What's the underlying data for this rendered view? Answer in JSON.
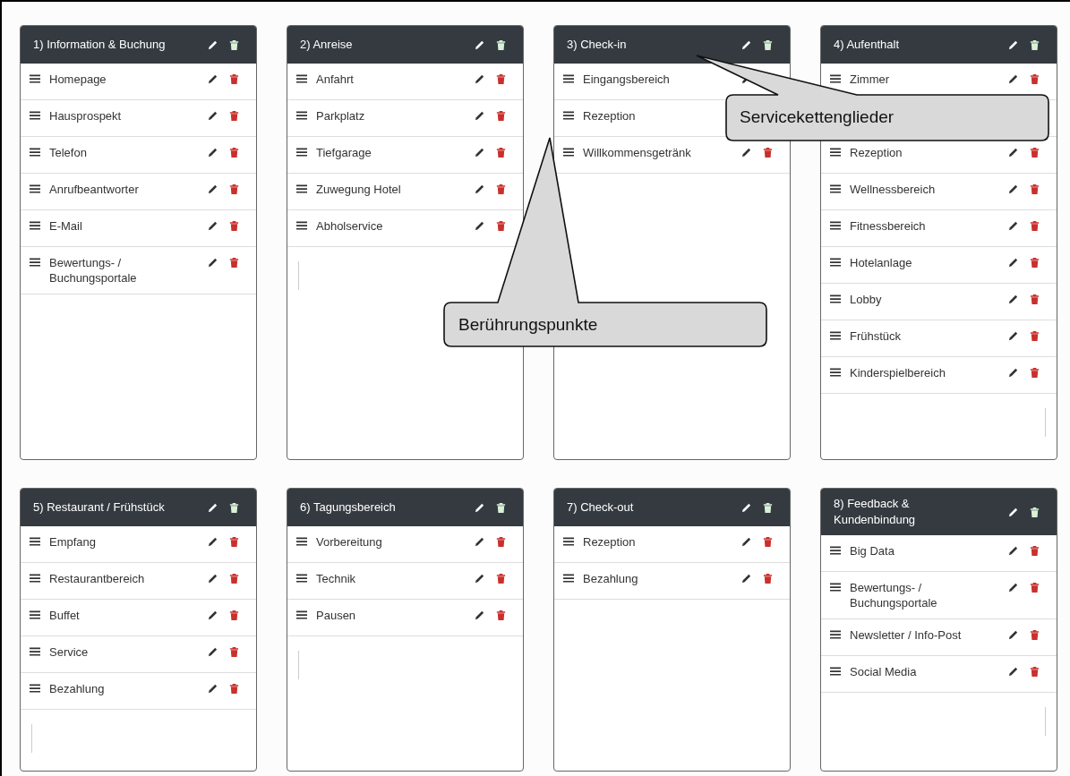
{
  "cards": [
    {
      "title": "1) Information & Buchung",
      "items": [
        {
          "kind": "entry",
          "label": "Homepage"
        },
        {
          "kind": "entry",
          "label": "Hausprospekt"
        },
        {
          "kind": "entry",
          "label": "Telefon"
        },
        {
          "kind": "entry",
          "label": "Anrufbeantworter"
        },
        {
          "kind": "entry",
          "label": "E-Mail"
        },
        {
          "kind": "entry",
          "label": "Bewertungs- / Buchungsportale"
        }
      ]
    },
    {
      "title": "2) Anreise",
      "input": {
        "kind": "left"
      },
      "items": [
        {
          "kind": "entry",
          "label": "Anfahrt"
        },
        {
          "kind": "entry",
          "label": "Parkplatz"
        },
        {
          "kind": "entry",
          "label": "Tiefgarage"
        },
        {
          "kind": "entry",
          "label": "Zuwegung Hotel"
        },
        {
          "kind": "entry",
          "label": "Abholservice"
        }
      ]
    },
    {
      "title": "3) Check-in",
      "items": [
        {
          "kind": "pencil-only",
          "label": "Eingangsbereich"
        },
        {
          "kind": "label-only",
          "label": "Rezeption"
        },
        {
          "kind": "entry",
          "label": "Willkommensgetränk"
        }
      ]
    },
    {
      "title": "4) Aufenthalt",
      "input": {
        "kind": "right"
      },
      "items": [
        {
          "kind": "entry",
          "label": "Zimmer"
        },
        {
          "kind": "covered"
        },
        {
          "kind": "entry",
          "label": "Rezeption"
        },
        {
          "kind": "entry",
          "label": "Wellnessbereich"
        },
        {
          "kind": "entry",
          "label": "Fitnessbereich"
        },
        {
          "kind": "entry",
          "label": "Hotelanlage"
        },
        {
          "kind": "entry",
          "label": "Lobby"
        },
        {
          "kind": "entry",
          "label": "Frühstück"
        },
        {
          "kind": "entry",
          "label": "Kinderspielbereich"
        }
      ]
    },
    {
      "title": "5) Restaurant / Frühstück",
      "input": {
        "kind": "left"
      },
      "items": [
        {
          "kind": "entry",
          "label": "Empfang"
        },
        {
          "kind": "entry",
          "label": "Restaurantbereich"
        },
        {
          "kind": "entry",
          "label": "Buffet"
        },
        {
          "kind": "entry",
          "label": "Service"
        },
        {
          "kind": "entry",
          "label": "Bezahlung"
        }
      ]
    },
    {
      "title": "6) Tagungsbereich",
      "input": {
        "kind": "left"
      },
      "items": [
        {
          "kind": "entry",
          "label": "Vorbereitung"
        },
        {
          "kind": "entry",
          "label": "Technik"
        },
        {
          "kind": "entry",
          "label": "Pausen"
        }
      ]
    },
    {
      "title": "7) Check-out",
      "items": [
        {
          "kind": "entry",
          "label": "Rezeption"
        },
        {
          "kind": "entry",
          "label": "Bezahlung"
        }
      ]
    },
    {
      "title": "8) Feedback & Kundenbindung",
      "input": {
        "kind": "right"
      },
      "items": [
        {
          "kind": "entry",
          "label": "Big Data"
        },
        {
          "kind": "entry",
          "label": "Bewertungs- / Buchungsportale"
        },
        {
          "kind": "entry",
          "label": "Newsletter / Info-Post"
        },
        {
          "kind": "entry",
          "label": "Social Media"
        }
      ]
    }
  ],
  "callouts": [
    {
      "text": "Servicekettenglieder"
    },
    {
      "text": "Berührungspunkte"
    }
  ]
}
